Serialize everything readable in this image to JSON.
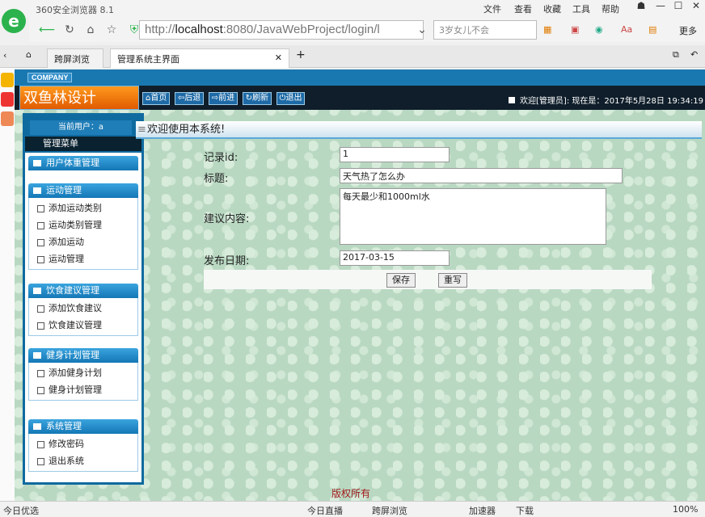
{
  "browser": {
    "title": "360安全浏览器 8.1",
    "menus": [
      "文件",
      "查看",
      "收藏",
      "工具",
      "帮助"
    ],
    "url_host": "localhost",
    "url_prefix": "http://",
    "url_rest": ":8080/JavaWebProject/login/l",
    "search_text": "3岁女儿不会",
    "more_label": "更多",
    "tabs": [
      {
        "label": "跨屏浏览"
      },
      {
        "label": "管理系统主界面"
      }
    ]
  },
  "app": {
    "company": "COMPANY",
    "brand": "双鱼林设计",
    "nav": [
      "首页",
      "后退",
      "前进",
      "刷新",
      "退出"
    ],
    "welcome": "欢迎[管理员]:     现在是：2017年5月28日  19:34:19",
    "current_user_label": "当前用户：a",
    "manage_menu": "管理菜单",
    "sidebar_groups": [
      {
        "title": "用户体重管理",
        "items": []
      },
      {
        "title": "运动管理",
        "items": [
          "添加运动类别",
          "运动类别管理",
          "添加运动",
          "运动管理"
        ]
      },
      {
        "title": "饮食建议管理",
        "items": [
          "添加饮食建议",
          "饮食建议管理"
        ]
      },
      {
        "title": "健身计划管理",
        "items": [
          "添加健身计划",
          "健身计划管理"
        ]
      },
      {
        "title": "系统管理",
        "items": [
          "修改密码",
          "退出系统"
        ]
      }
    ],
    "content_title": "欢迎使用本系统!",
    "form": {
      "id_label": "记录id:",
      "id_value": "1",
      "title_label": "标题:",
      "title_value": "天气热了怎么办",
      "content_label": "建议内容:",
      "content_value": "每天最少和1000ml水",
      "date_label": "发布日期:",
      "date_value": "2017-03-15",
      "save_label": "保存",
      "reset_label": "重写"
    },
    "copyright": "版权所有"
  },
  "statusbar": {
    "left": "今日优选",
    "live": "今日直播",
    "cross": "跨屏浏览",
    "accel": "加速器",
    "download": "下载",
    "zoom": "100%"
  },
  "colors": {
    "header_dark": "#0f1e2a",
    "accent_blue": "#1477b6",
    "brand_orange": "#ff9a1f",
    "page_green": "#b9d8c2",
    "copyright_red": "#a01818"
  }
}
